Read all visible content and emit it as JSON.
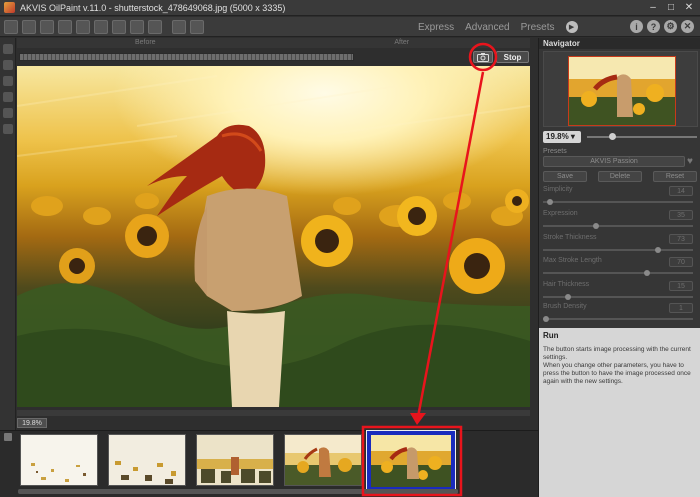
{
  "window": {
    "title": "AKVIS OilPaint v.11.0 - shutterstock_478649068.jpg (5000 x 3335)",
    "controls": [
      "minimize",
      "maximize",
      "close"
    ]
  },
  "toolbar": {
    "modes": [
      "Express",
      "Advanced",
      "Presets"
    ],
    "icons": [
      "open-icon",
      "save-icon",
      "print-icon",
      "share-icon",
      "batch-icon",
      "canvas-icon",
      "settings-icon",
      "brush-icon",
      "check-icon",
      "undo-icon",
      "redo-icon"
    ],
    "right_icons": [
      "info-icon",
      "help-icon",
      "preferences-icon",
      "close-app-icon"
    ]
  },
  "view": {
    "before_label": "Before",
    "after_label": "After",
    "stop_label": "Stop",
    "zoom": "19.8%"
  },
  "navigator": {
    "title": "Navigator",
    "zoom": "19.8%"
  },
  "presets": {
    "label": "Presets",
    "selected": "AKVIS Passion",
    "save": "Save",
    "delete": "Delete",
    "reset": "Reset"
  },
  "params": [
    {
      "label": "Simplicity",
      "value": "14",
      "level": 0.03
    },
    {
      "label": "Expression",
      "value": "35",
      "level": 0.35
    },
    {
      "label": "Stroke Thickness",
      "value": "73",
      "level": 0.78
    },
    {
      "label": "Max Stroke Length",
      "value": "70",
      "level": 0.7
    },
    {
      "label": "Hair Thickness",
      "value": "15",
      "level": 0.15
    },
    {
      "label": "Brush Density",
      "value": "1",
      "level": 0.0
    }
  ],
  "hint": {
    "title": "Run",
    "lines": [
      "The button starts image processing with the current settings.",
      "When you change other parameters, you have to press the button to have the image processed once again with the new settings."
    ]
  },
  "annotation_colors": {
    "highlight": "#e8141c",
    "selection": "#1a2bbd"
  }
}
